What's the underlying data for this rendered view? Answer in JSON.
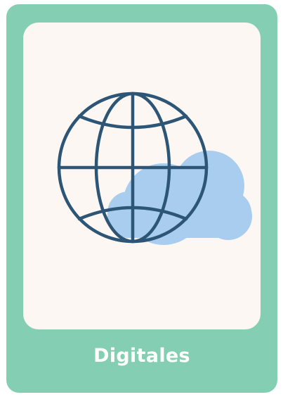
{
  "card": {
    "title": "Digitales",
    "icon": "globe-with-cloud-icon"
  },
  "colors": {
    "card_background": "#84cfb3",
    "panel_background": "#fdf7f3",
    "globe_stroke": "#2c5576",
    "cloud_fill": "#a9cdee",
    "label_text": "#ffffff"
  }
}
